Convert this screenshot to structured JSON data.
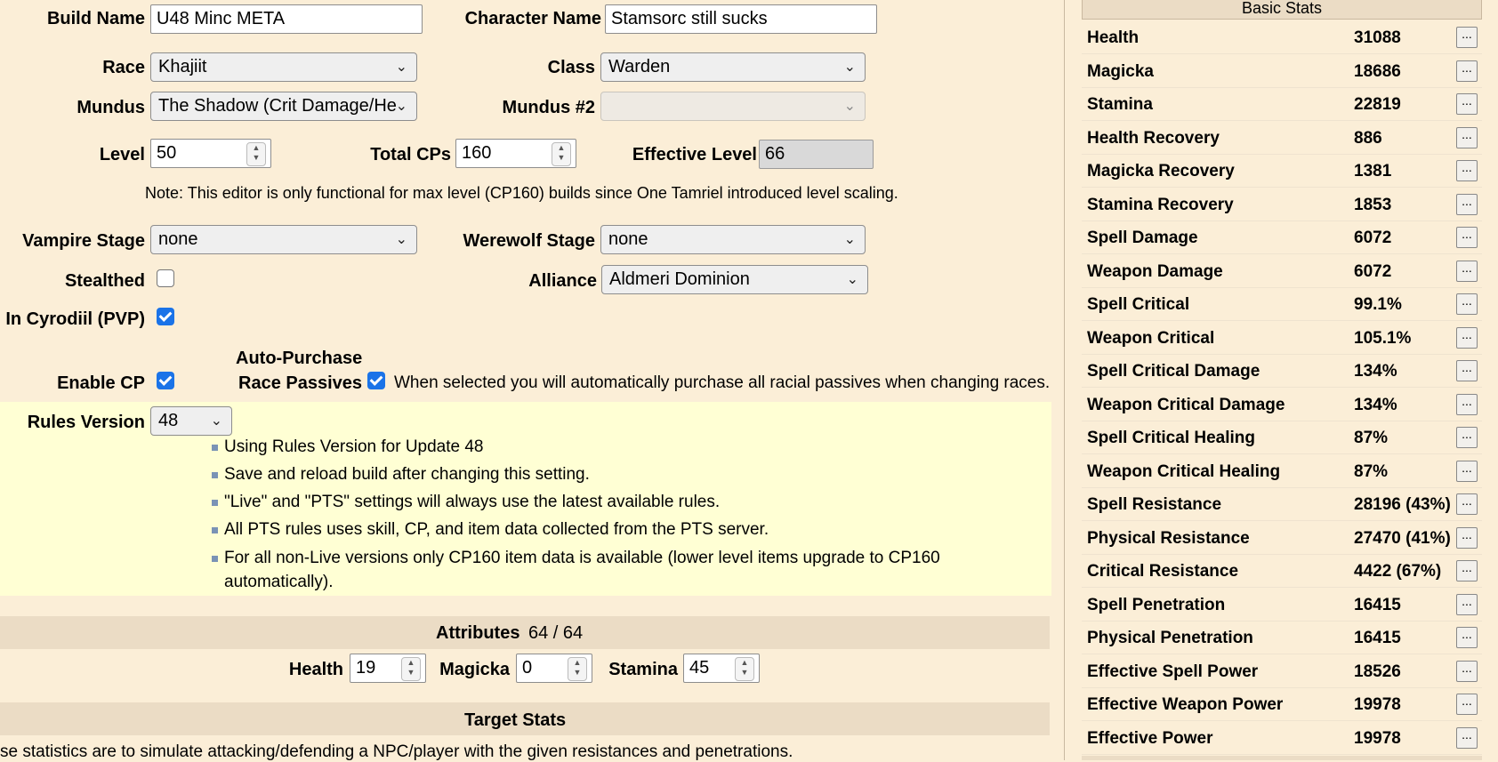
{
  "build": {
    "build_name_label": "Build Name",
    "build_name_value": "U48 Minc META",
    "character_name_label": "Character Name",
    "character_name_value": "Stamsorc still sucks",
    "race_label": "Race",
    "race_value": "Khajiit",
    "class_label": "Class",
    "class_value": "Warden",
    "mundus_label": "Mundus",
    "mundus_value": "The Shadow (Crit Damage/He",
    "mundus2_label": "Mundus #2",
    "mundus2_value": "",
    "level_label": "Level",
    "level_value": "50",
    "total_cps_label": "Total CPs",
    "total_cps_value": "160",
    "effective_level_label": "Effective Level",
    "effective_level_value": "66",
    "note": "Note: This editor is only functional for max level (CP160) builds since One Tamriel introduced level scaling.",
    "vampire_label": "Vampire Stage",
    "vampire_value": "none",
    "werewolf_label": "Werewolf Stage",
    "werewolf_value": "none",
    "stealthed_label": "Stealthed",
    "stealthed_checked": false,
    "alliance_label": "Alliance",
    "alliance_value": "Aldmeri Dominion",
    "cyrodiil_label": "In Cyrodiil (PVP)",
    "cyrodiil_checked": true,
    "enable_cp_label": "Enable CP",
    "enable_cp_checked": true,
    "auto_purchase_label_1": "Auto-Purchase",
    "auto_purchase_label_2": "Race Passives",
    "auto_purchase_checked": true,
    "auto_purchase_desc": "When selected you will automatically purchase all racial passives when changing races."
  },
  "rules": {
    "label": "Rules Version",
    "value": "48",
    "items": [
      "Using Rules Version for Update 48",
      "Save and reload build after changing this setting.",
      "\"Live\" and \"PTS\" settings will always use the latest available rules.",
      "All PTS rules uses skill, CP, and item data collected from the PTS server.",
      "For all non-Live versions only CP160 item data is available (lower level items upgrade to CP160",
      "automatically)."
    ]
  },
  "attributes": {
    "title": "Attributes",
    "count": "64 / 64",
    "health_label": "Health",
    "health_value": "19",
    "magicka_label": "Magicka",
    "magicka_value": "0",
    "stamina_label": "Stamina",
    "stamina_value": "45"
  },
  "target": {
    "title": "Target Stats",
    "desc": "se statistics are to simulate attacking/defending a NPC/player with the given resistances and penetrations."
  },
  "stats": {
    "title": "Basic Stats",
    "button_label": "...",
    "rows": [
      {
        "name": "Health",
        "value": "31088"
      },
      {
        "name": "Magicka",
        "value": "18686"
      },
      {
        "name": "Stamina",
        "value": "22819"
      },
      {
        "name": "Health Recovery",
        "value": "886"
      },
      {
        "name": "Magicka Recovery",
        "value": "1381"
      },
      {
        "name": "Stamina Recovery",
        "value": "1853"
      },
      {
        "name": "Spell Damage",
        "value": "6072"
      },
      {
        "name": "Weapon Damage",
        "value": "6072"
      },
      {
        "name": "Spell Critical",
        "value": "99.1%"
      },
      {
        "name": "Weapon Critical",
        "value": "105.1%"
      },
      {
        "name": "Spell Critical Damage",
        "value": "134%"
      },
      {
        "name": "Weapon Critical Damage",
        "value": "134%"
      },
      {
        "name": "Spell Critical Healing",
        "value": "87%"
      },
      {
        "name": "Weapon Critical Healing",
        "value": "87%"
      },
      {
        "name": "Spell Resistance",
        "value": "28196 (43%)"
      },
      {
        "name": "Physical Resistance",
        "value": "27470 (41%)"
      },
      {
        "name": "Critical Resistance",
        "value": "4422 (67%)"
      },
      {
        "name": "Spell Penetration",
        "value": "16415"
      },
      {
        "name": "Physical Penetration",
        "value": "16415"
      },
      {
        "name": "Effective Spell Power",
        "value": "18526"
      },
      {
        "name": "Effective Weapon Power",
        "value": "19978"
      },
      {
        "name": "Effective Power",
        "value": "19978"
      }
    ]
  }
}
